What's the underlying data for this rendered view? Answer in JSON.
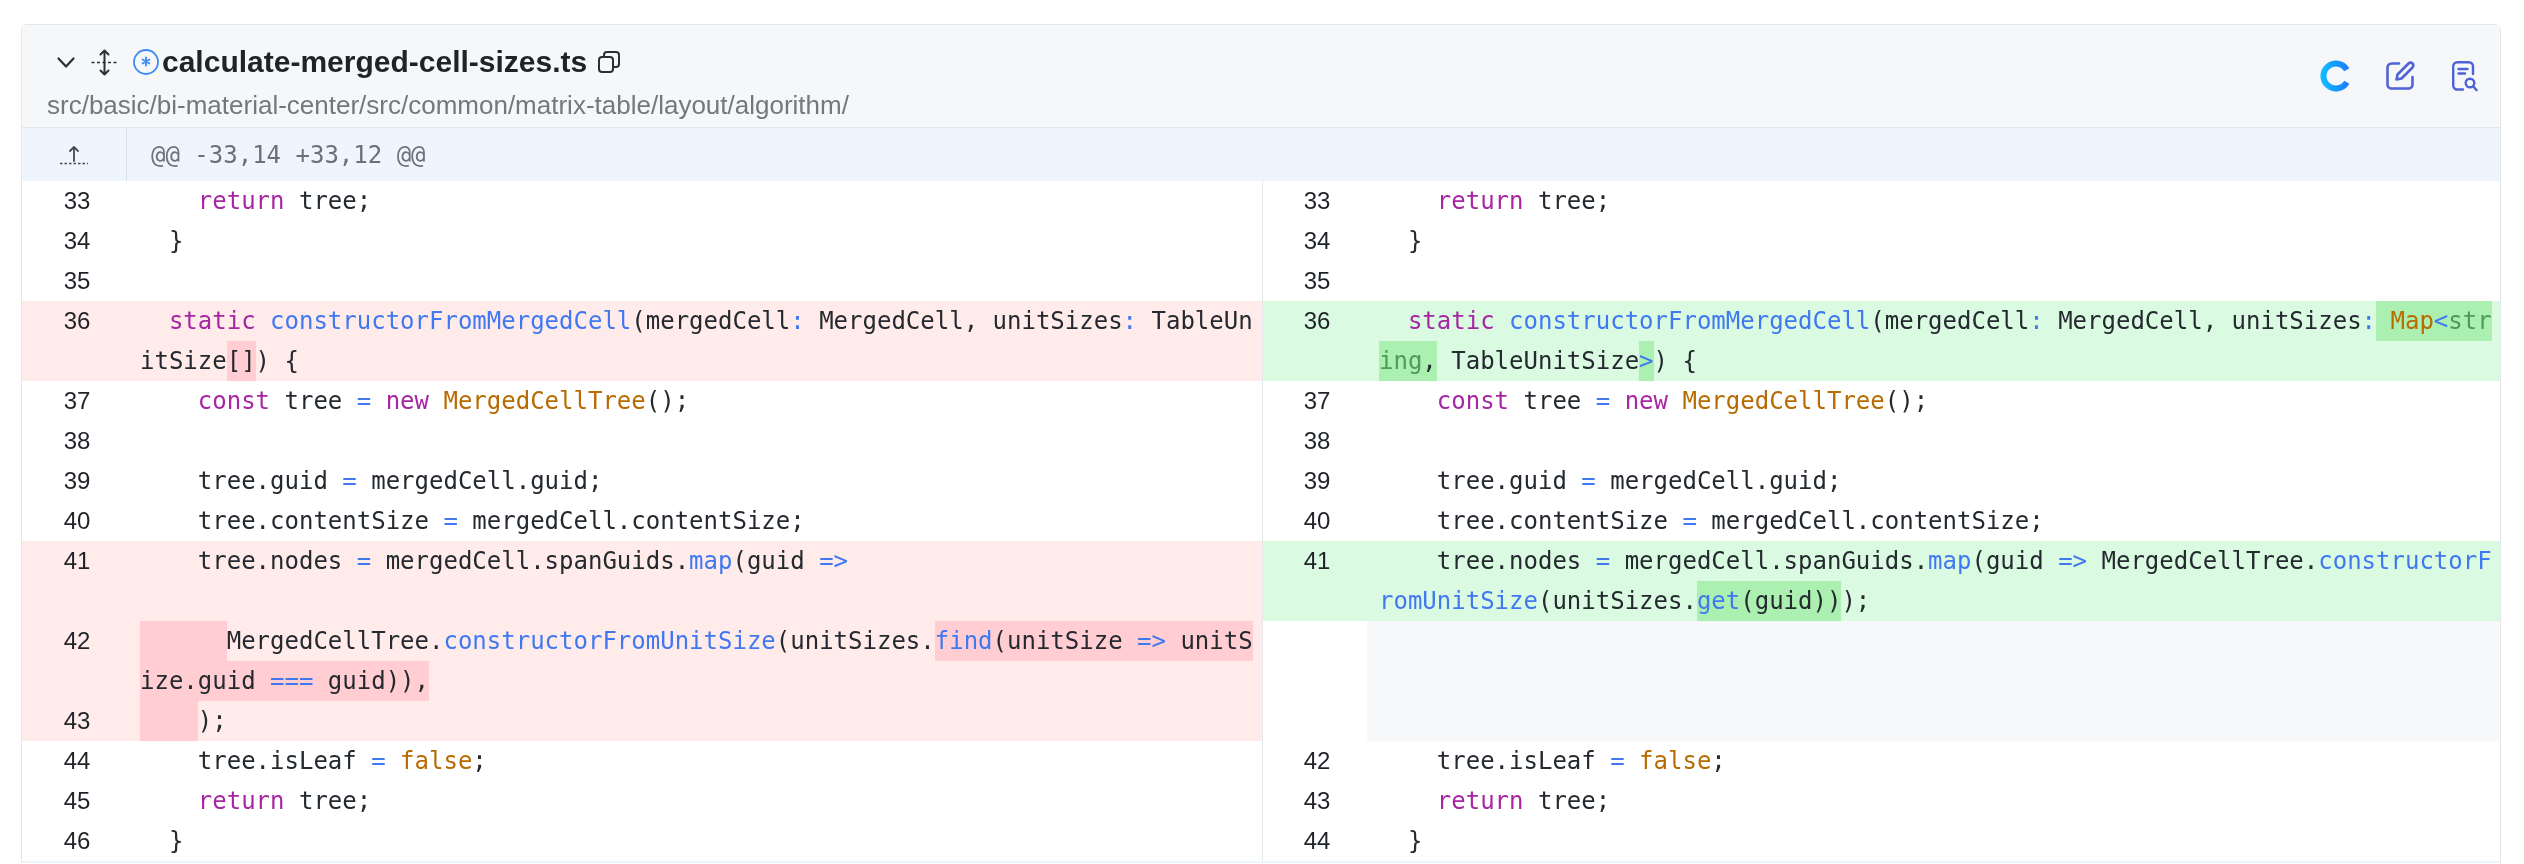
{
  "file": {
    "expanded": true,
    "name": "calculate-merged-cell-sizes.ts",
    "path": "src/basic/bi-material-center/src/common/matrix-table/layout/algorithm/"
  },
  "hunk": {
    "header": "@@ -33,14 +33,12 @@"
  },
  "rows": [
    {
      "left": {
        "number": "33",
        "kind": "context",
        "indent_changed": false,
        "tokens": [
          {
            "text": "    return",
            "kind": "keyword",
            "changed": false
          },
          {
            "text": " tree;",
            "kind": "plain",
            "changed": false
          }
        ]
      },
      "right": {
        "number": "33",
        "kind": "context",
        "indent_changed": false,
        "tokens": [
          {
            "text": "    return",
            "kind": "keyword",
            "changed": false
          },
          {
            "text": " tree;",
            "kind": "plain",
            "changed": false
          }
        ]
      }
    },
    {
      "left": {
        "number": "34",
        "kind": "context",
        "indent_changed": false,
        "tokens": [
          {
            "text": "  }",
            "kind": "plain",
            "changed": false
          }
        ]
      },
      "right": {
        "number": "34",
        "kind": "context",
        "indent_changed": false,
        "tokens": [
          {
            "text": "  }",
            "kind": "plain",
            "changed": false
          }
        ]
      }
    },
    {
      "left": {
        "number": "35",
        "kind": "context"
      },
      "right": {
        "number": "35",
        "kind": "context"
      }
    },
    {
      "left": {
        "number": "36",
        "kind": "deleted",
        "indent_changed": false,
        "tokens": [
          {
            "text": "  static",
            "kind": "keyword",
            "changed": false
          },
          {
            "text": " constructorFromMergedCell",
            "kind": "function",
            "changed": false
          },
          {
            "text": "(mergedCell",
            "kind": "plain",
            "changed": false
          },
          {
            "text": ":",
            "kind": "operator",
            "changed": false
          },
          {
            "text": " MergedCell, unitSizes",
            "kind": "plain",
            "changed": false
          },
          {
            "text": ":",
            "kind": "operator",
            "changed": false
          },
          {
            "text": " TableUnitSize",
            "kind": "plain",
            "changed": false
          },
          {
            "text": "[]",
            "kind": "plain",
            "changed": true
          },
          {
            "text": ") {",
            "kind": "plain",
            "changed": false
          }
        ]
      },
      "right": {
        "number": "36",
        "kind": "added",
        "indent_changed": false,
        "tokens": [
          {
            "text": "  static",
            "kind": "keyword",
            "changed": false
          },
          {
            "text": " constructorFromMergedCell",
            "kind": "function",
            "changed": false
          },
          {
            "text": "(mergedCell",
            "kind": "plain",
            "changed": false
          },
          {
            "text": ":",
            "kind": "operator",
            "changed": false
          },
          {
            "text": " MergedCell, unitSizes",
            "kind": "plain",
            "changed": false
          },
          {
            "text": ":",
            "kind": "operator",
            "changed": false
          },
          {
            "text": " Map",
            "kind": "class",
            "changed": true
          },
          {
            "text": "<",
            "kind": "operator",
            "changed": true
          },
          {
            "text": "string",
            "kind": "type",
            "changed": true
          },
          {
            "text": ",",
            "kind": "plain",
            "changed": true
          },
          {
            "text": " TableUnitSize",
            "kind": "plain",
            "changed": false
          },
          {
            "text": ">",
            "kind": "operator",
            "changed": true
          },
          {
            "text": ") {",
            "kind": "plain",
            "changed": false
          }
        ]
      }
    },
    {
      "left": {
        "number": "37",
        "kind": "context",
        "indent_changed": false,
        "tokens": [
          {
            "text": "    const",
            "kind": "keyword",
            "changed": false
          },
          {
            "text": " tree ",
            "kind": "plain",
            "changed": false
          },
          {
            "text": "=",
            "kind": "operator",
            "changed": false
          },
          {
            "text": " new",
            "kind": "keyword",
            "changed": false
          },
          {
            "text": " MergedCellTree",
            "kind": "class",
            "changed": false
          },
          {
            "text": "();",
            "kind": "plain",
            "changed": false
          }
        ]
      },
      "right": {
        "number": "37",
        "kind": "context",
        "indent_changed": false,
        "tokens": [
          {
            "text": "    const",
            "kind": "keyword",
            "changed": false
          },
          {
            "text": " tree ",
            "kind": "plain",
            "changed": false
          },
          {
            "text": "=",
            "kind": "operator",
            "changed": false
          },
          {
            "text": " new",
            "kind": "keyword",
            "changed": false
          },
          {
            "text": " MergedCellTree",
            "kind": "class",
            "changed": false
          },
          {
            "text": "();",
            "kind": "plain",
            "changed": false
          }
        ]
      }
    },
    {
      "left": {
        "number": "38",
        "kind": "context"
      },
      "right": {
        "number": "38",
        "kind": "context"
      }
    },
    {
      "left": {
        "number": "39",
        "kind": "context",
        "indent_changed": false,
        "tokens": [
          {
            "text": "    tree.guid ",
            "kind": "plain",
            "changed": false
          },
          {
            "text": "=",
            "kind": "operator",
            "changed": false
          },
          {
            "text": " mergedCell.guid;",
            "kind": "plain",
            "changed": false
          }
        ]
      },
      "right": {
        "number": "39",
        "kind": "context",
        "indent_changed": false,
        "tokens": [
          {
            "text": "    tree.guid ",
            "kind": "plain",
            "changed": false
          },
          {
            "text": "=",
            "kind": "operator",
            "changed": false
          },
          {
            "text": " mergedCell.guid;",
            "kind": "plain",
            "changed": false
          }
        ]
      }
    },
    {
      "left": {
        "number": "40",
        "kind": "context",
        "indent_changed": false,
        "tokens": [
          {
            "text": "    tree.contentSize ",
            "kind": "plain",
            "changed": false
          },
          {
            "text": "=",
            "kind": "operator",
            "changed": false
          },
          {
            "text": " mergedCell.contentSize;",
            "kind": "plain",
            "changed": false
          }
        ]
      },
      "right": {
        "number": "40",
        "kind": "context",
        "indent_changed": false,
        "tokens": [
          {
            "text": "    tree.contentSize ",
            "kind": "plain",
            "changed": false
          },
          {
            "text": "=",
            "kind": "operator",
            "changed": false
          },
          {
            "text": " mergedCell.contentSize;",
            "kind": "plain",
            "changed": false
          }
        ]
      }
    },
    {
      "left": {
        "number": "41",
        "kind": "deleted",
        "indent_changed": false,
        "tokens": [
          {
            "text": "    tree.nodes ",
            "kind": "plain",
            "changed": false
          },
          {
            "text": "=",
            "kind": "operator",
            "changed": false
          },
          {
            "text": " mergedCell.spanGuids.",
            "kind": "plain",
            "changed": false
          },
          {
            "text": "map",
            "kind": "function",
            "changed": false
          },
          {
            "text": "(guid ",
            "kind": "plain",
            "changed": false
          },
          {
            "text": "=>",
            "kind": "operator",
            "changed": false
          }
        ]
      },
      "right": {
        "number": "41",
        "kind": "added",
        "indent_changed": false,
        "tokens": [
          {
            "text": "    tree.nodes ",
            "kind": "plain",
            "changed": false
          },
          {
            "text": "=",
            "kind": "operator",
            "changed": false
          },
          {
            "text": " mergedCell.spanGuids.",
            "kind": "plain",
            "changed": false
          },
          {
            "text": "map",
            "kind": "function",
            "changed": false
          },
          {
            "text": "(guid ",
            "kind": "plain",
            "changed": false
          },
          {
            "text": "=>",
            "kind": "operator",
            "changed": false
          },
          {
            "text": " MergedCellTree.",
            "kind": "plain",
            "changed": false
          },
          {
            "text": "constructorFromUnitSize",
            "kind": "function",
            "changed": false
          },
          {
            "text": "(unitSizes.",
            "kind": "plain",
            "changed": false
          },
          {
            "text": "get",
            "kind": "function",
            "changed": true
          },
          {
            "text": "(guid))",
            "kind": "plain",
            "changed": true
          },
          {
            "text": ");",
            "kind": "plain",
            "changed": false
          }
        ]
      }
    },
    {
      "left": {
        "number": "42",
        "kind": "deleted",
        "indent_changed": true,
        "tokens": [
          {
            "text": "      MergedCellTree.",
            "kind": "plain",
            "changed": false
          },
          {
            "text": "constructorFromUnitSize",
            "kind": "function",
            "changed": false
          },
          {
            "text": "(unitSizes.",
            "kind": "plain",
            "changed": false
          },
          {
            "text": "find",
            "kind": "function",
            "changed": true
          },
          {
            "text": "(unitSize ",
            "kind": "plain",
            "changed": true
          },
          {
            "text": "=>",
            "kind": "operator",
            "changed": true
          },
          {
            "text": " unitSize.guid ",
            "kind": "plain",
            "changed": true
          },
          {
            "text": "===",
            "kind": "operator",
            "changed": true
          },
          {
            "text": " guid)),",
            "kind": "plain",
            "changed": true
          }
        ]
      }
    },
    {
      "left": {
        "number": "43",
        "kind": "deleted",
        "indent_changed": true,
        "tokens": [
          {
            "text": "    );",
            "kind": "plain",
            "changed": false
          }
        ]
      }
    },
    {
      "left": {
        "number": "44",
        "kind": "context",
        "indent_changed": false,
        "tokens": [
          {
            "text": "    tree.isLeaf ",
            "kind": "plain",
            "changed": false
          },
          {
            "text": "=",
            "kind": "operator",
            "changed": false
          },
          {
            "text": " false",
            "kind": "literal",
            "changed": false
          },
          {
            "text": ";",
            "kind": "plain",
            "changed": false
          }
        ]
      },
      "right": {
        "number": "42",
        "kind": "context",
        "indent_changed": false,
        "tokens": [
          {
            "text": "    tree.isLeaf ",
            "kind": "plain",
            "changed": false
          },
          {
            "text": "=",
            "kind": "operator",
            "changed": false
          },
          {
            "text": " false",
            "kind": "literal",
            "changed": false
          },
          {
            "text": ";",
            "kind": "plain",
            "changed": false
          }
        ]
      }
    },
    {
      "left": {
        "number": "45",
        "kind": "context",
        "indent_changed": false,
        "tokens": [
          {
            "text": "    return",
            "kind": "keyword",
            "changed": false
          },
          {
            "text": " tree;",
            "kind": "plain",
            "changed": false
          }
        ]
      },
      "right": {
        "number": "43",
        "kind": "context",
        "indent_changed": false,
        "tokens": [
          {
            "text": "    return",
            "kind": "keyword",
            "changed": false
          },
          {
            "text": " tree;",
            "kind": "plain",
            "changed": false
          }
        ]
      }
    },
    {
      "left": {
        "number": "46",
        "kind": "context",
        "indent_changed": false,
        "tokens": [
          {
            "text": "  }",
            "kind": "plain",
            "changed": false
          }
        ]
      },
      "right": {
        "number": "44",
        "kind": "context",
        "indent_changed": false,
        "tokens": [
          {
            "text": "  }",
            "kind": "plain",
            "changed": false
          }
        ]
      }
    }
  ]
}
